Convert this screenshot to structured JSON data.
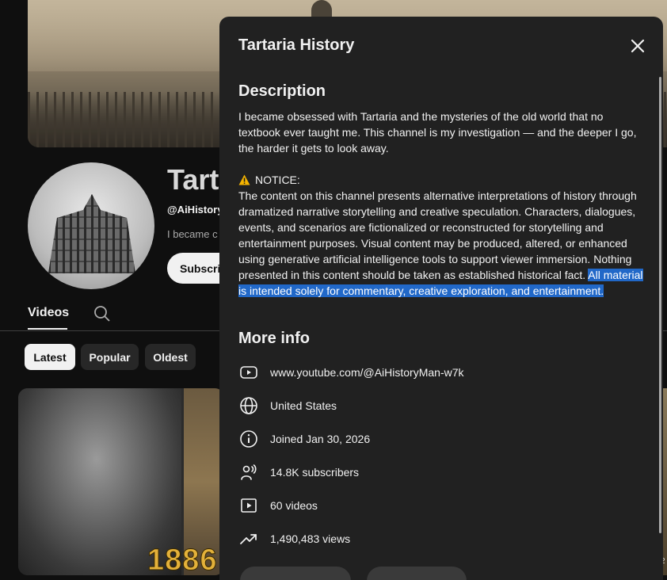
{
  "channel": {
    "title": "Tart",
    "handle": "@AiHistory",
    "description_preview": "I became c",
    "subscribe_label": "Subscri"
  },
  "tabs": {
    "videos_label": "Videos"
  },
  "chips": {
    "latest": "Latest",
    "popular": "Popular",
    "oldest": "Oldest"
  },
  "thumbnail": {
    "year_text": "1886",
    "side_label": "2"
  },
  "modal": {
    "title": "Tartaria History",
    "description_heading": "Description",
    "description_intro": "I became obsessed with Tartaria and the mysteries of the old world that no textbook ever taught me. This channel is my investigation — and the deeper I go, the harder it gets to look away.",
    "notice_label": "NOTICE:",
    "notice_body": "The content on this channel presents alternative interpretations of history through dramatized narrative storytelling and creative speculation. Characters, dialogues, events, and scenarios are fictionalized or reconstructed for storytelling and entertainment purposes. Visual content may be produced, altered, or enhanced using generative artificial intelligence tools to support viewer immersion. Nothing presented in this content should be taken as established historical fact. ",
    "notice_highlighted": "All material is intended solely for commentary, creative exploration, and entertainment.",
    "more_info_heading": "More info",
    "info": {
      "url": "www.youtube.com/@AiHistoryMan-w7k",
      "country": "United States",
      "joined": "Joined Jan 30, 2026",
      "subscribers": "14.8K subscribers",
      "videos": "60 videos",
      "views": "1,490,483 views"
    }
  },
  "colors": {
    "page_bg": "#0f0f0f",
    "modal_bg": "#212121",
    "selection_highlight": "#2168c8",
    "thumbnail_year": "#e3b13a"
  }
}
